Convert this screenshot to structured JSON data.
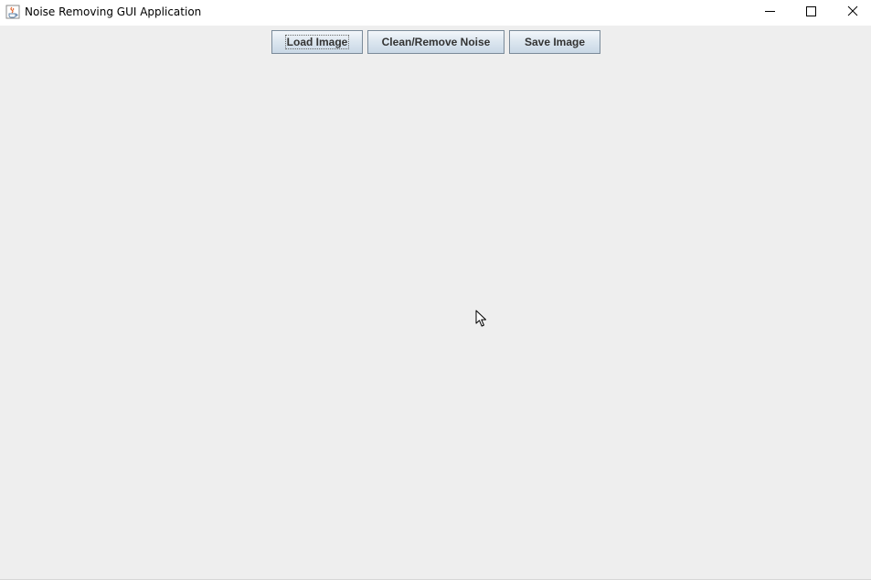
{
  "window": {
    "title": "Noise Removing GUI Application",
    "app_icon": "java-coffee-cup-icon",
    "controls": {
      "minimize_icon": "minimize-icon",
      "maximize_icon": "maximize-icon",
      "close_icon": "close-icon"
    }
  },
  "toolbar": {
    "load_label": "Load Image",
    "clean_label": "Clean/Remove Noise",
    "save_label": "Save Image"
  },
  "colors": {
    "background": "#eeeeee",
    "titlebar": "#ffffff",
    "button_border": "#7a8a99",
    "button_text": "#333333"
  }
}
